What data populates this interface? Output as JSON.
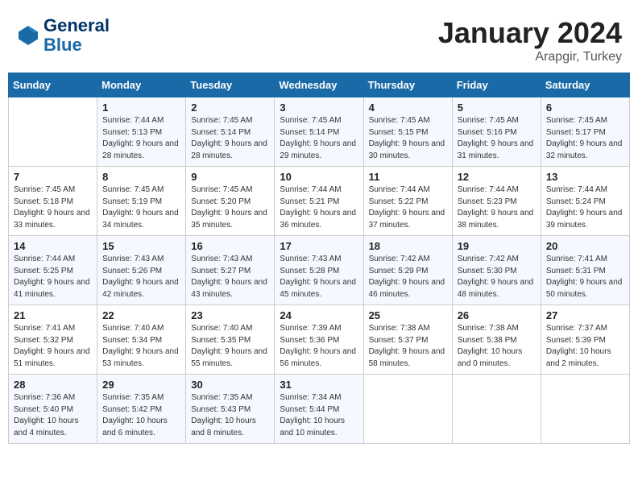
{
  "header": {
    "logo_line1": "General",
    "logo_line2": "Blue",
    "title": "January 2024",
    "subtitle": "Arapgir, Turkey"
  },
  "weekdays": [
    "Sunday",
    "Monday",
    "Tuesday",
    "Wednesday",
    "Thursday",
    "Friday",
    "Saturday"
  ],
  "weeks": [
    [
      {
        "day": "",
        "sunrise": "",
        "sunset": "",
        "daylight": ""
      },
      {
        "day": "1",
        "sunrise": "Sunrise: 7:44 AM",
        "sunset": "Sunset: 5:13 PM",
        "daylight": "Daylight: 9 hours and 28 minutes."
      },
      {
        "day": "2",
        "sunrise": "Sunrise: 7:45 AM",
        "sunset": "Sunset: 5:14 PM",
        "daylight": "Daylight: 9 hours and 28 minutes."
      },
      {
        "day": "3",
        "sunrise": "Sunrise: 7:45 AM",
        "sunset": "Sunset: 5:14 PM",
        "daylight": "Daylight: 9 hours and 29 minutes."
      },
      {
        "day": "4",
        "sunrise": "Sunrise: 7:45 AM",
        "sunset": "Sunset: 5:15 PM",
        "daylight": "Daylight: 9 hours and 30 minutes."
      },
      {
        "day": "5",
        "sunrise": "Sunrise: 7:45 AM",
        "sunset": "Sunset: 5:16 PM",
        "daylight": "Daylight: 9 hours and 31 minutes."
      },
      {
        "day": "6",
        "sunrise": "Sunrise: 7:45 AM",
        "sunset": "Sunset: 5:17 PM",
        "daylight": "Daylight: 9 hours and 32 minutes."
      }
    ],
    [
      {
        "day": "7",
        "sunrise": "Sunrise: 7:45 AM",
        "sunset": "Sunset: 5:18 PM",
        "daylight": "Daylight: 9 hours and 33 minutes."
      },
      {
        "day": "8",
        "sunrise": "Sunrise: 7:45 AM",
        "sunset": "Sunset: 5:19 PM",
        "daylight": "Daylight: 9 hours and 34 minutes."
      },
      {
        "day": "9",
        "sunrise": "Sunrise: 7:45 AM",
        "sunset": "Sunset: 5:20 PM",
        "daylight": "Daylight: 9 hours and 35 minutes."
      },
      {
        "day": "10",
        "sunrise": "Sunrise: 7:44 AM",
        "sunset": "Sunset: 5:21 PM",
        "daylight": "Daylight: 9 hours and 36 minutes."
      },
      {
        "day": "11",
        "sunrise": "Sunrise: 7:44 AM",
        "sunset": "Sunset: 5:22 PM",
        "daylight": "Daylight: 9 hours and 37 minutes."
      },
      {
        "day": "12",
        "sunrise": "Sunrise: 7:44 AM",
        "sunset": "Sunset: 5:23 PM",
        "daylight": "Daylight: 9 hours and 38 minutes."
      },
      {
        "day": "13",
        "sunrise": "Sunrise: 7:44 AM",
        "sunset": "Sunset: 5:24 PM",
        "daylight": "Daylight: 9 hours and 39 minutes."
      }
    ],
    [
      {
        "day": "14",
        "sunrise": "Sunrise: 7:44 AM",
        "sunset": "Sunset: 5:25 PM",
        "daylight": "Daylight: 9 hours and 41 minutes."
      },
      {
        "day": "15",
        "sunrise": "Sunrise: 7:43 AM",
        "sunset": "Sunset: 5:26 PM",
        "daylight": "Daylight: 9 hours and 42 minutes."
      },
      {
        "day": "16",
        "sunrise": "Sunrise: 7:43 AM",
        "sunset": "Sunset: 5:27 PM",
        "daylight": "Daylight: 9 hours and 43 minutes."
      },
      {
        "day": "17",
        "sunrise": "Sunrise: 7:43 AM",
        "sunset": "Sunset: 5:28 PM",
        "daylight": "Daylight: 9 hours and 45 minutes."
      },
      {
        "day": "18",
        "sunrise": "Sunrise: 7:42 AM",
        "sunset": "Sunset: 5:29 PM",
        "daylight": "Daylight: 9 hours and 46 minutes."
      },
      {
        "day": "19",
        "sunrise": "Sunrise: 7:42 AM",
        "sunset": "Sunset: 5:30 PM",
        "daylight": "Daylight: 9 hours and 48 minutes."
      },
      {
        "day": "20",
        "sunrise": "Sunrise: 7:41 AM",
        "sunset": "Sunset: 5:31 PM",
        "daylight": "Daylight: 9 hours and 50 minutes."
      }
    ],
    [
      {
        "day": "21",
        "sunrise": "Sunrise: 7:41 AM",
        "sunset": "Sunset: 5:32 PM",
        "daylight": "Daylight: 9 hours and 51 minutes."
      },
      {
        "day": "22",
        "sunrise": "Sunrise: 7:40 AM",
        "sunset": "Sunset: 5:34 PM",
        "daylight": "Daylight: 9 hours and 53 minutes."
      },
      {
        "day": "23",
        "sunrise": "Sunrise: 7:40 AM",
        "sunset": "Sunset: 5:35 PM",
        "daylight": "Daylight: 9 hours and 55 minutes."
      },
      {
        "day": "24",
        "sunrise": "Sunrise: 7:39 AM",
        "sunset": "Sunset: 5:36 PM",
        "daylight": "Daylight: 9 hours and 56 minutes."
      },
      {
        "day": "25",
        "sunrise": "Sunrise: 7:38 AM",
        "sunset": "Sunset: 5:37 PM",
        "daylight": "Daylight: 9 hours and 58 minutes."
      },
      {
        "day": "26",
        "sunrise": "Sunrise: 7:38 AM",
        "sunset": "Sunset: 5:38 PM",
        "daylight": "Daylight: 10 hours and 0 minutes."
      },
      {
        "day": "27",
        "sunrise": "Sunrise: 7:37 AM",
        "sunset": "Sunset: 5:39 PM",
        "daylight": "Daylight: 10 hours and 2 minutes."
      }
    ],
    [
      {
        "day": "28",
        "sunrise": "Sunrise: 7:36 AM",
        "sunset": "Sunset: 5:40 PM",
        "daylight": "Daylight: 10 hours and 4 minutes."
      },
      {
        "day": "29",
        "sunrise": "Sunrise: 7:35 AM",
        "sunset": "Sunset: 5:42 PM",
        "daylight": "Daylight: 10 hours and 6 minutes."
      },
      {
        "day": "30",
        "sunrise": "Sunrise: 7:35 AM",
        "sunset": "Sunset: 5:43 PM",
        "daylight": "Daylight: 10 hours and 8 minutes."
      },
      {
        "day": "31",
        "sunrise": "Sunrise: 7:34 AM",
        "sunset": "Sunset: 5:44 PM",
        "daylight": "Daylight: 10 hours and 10 minutes."
      },
      {
        "day": "",
        "sunrise": "",
        "sunset": "",
        "daylight": ""
      },
      {
        "day": "",
        "sunrise": "",
        "sunset": "",
        "daylight": ""
      },
      {
        "day": "",
        "sunrise": "",
        "sunset": "",
        "daylight": ""
      }
    ]
  ]
}
